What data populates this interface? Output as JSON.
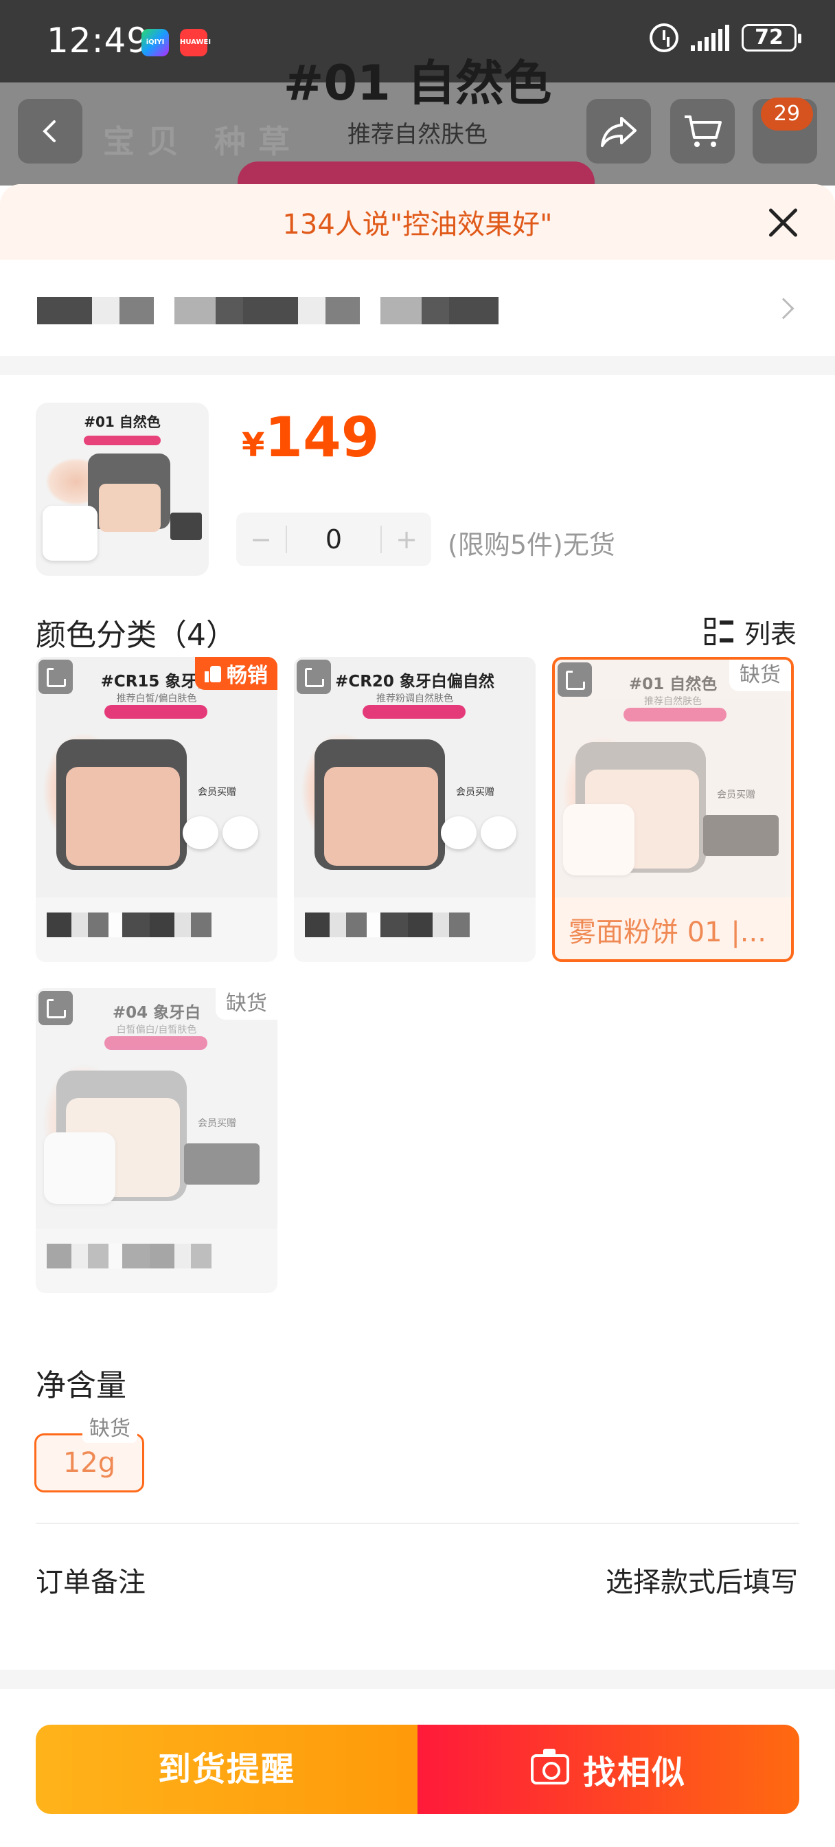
{
  "status_bar": {
    "time": "12:49",
    "apps": [
      "iQIYI",
      "HUAWEI"
    ],
    "battery": "72"
  },
  "background_header": {
    "title": "#01 自然色",
    "subtitle": "推荐自然肤色",
    "tabs": "宝贝 种草",
    "cart_badge": "29"
  },
  "sheet": {
    "banner": "134人说\"控油效果好\"",
    "price_currency": "¥",
    "price": "149",
    "quantity": "0",
    "qty_minus": "−",
    "qty_plus": "+",
    "limit_note": "(限购5件)无货",
    "thumb_label": "#01 自然色",
    "color_section_title": "颜色分类（4）",
    "list_toggle_label": "列表",
    "skus": [
      {
        "name": "#CR15 象牙白",
        "sub": "推荐白皙/偏白肤色",
        "badge": "畅销",
        "state": "hot"
      },
      {
        "name": "#CR20 象牙白偏自然",
        "sub": "推荐粉调自然肤色",
        "badge": "",
        "state": "normal"
      },
      {
        "name": "#01 自然色",
        "sub": "推荐自然肤色",
        "badge": "缺货",
        "state": "selected",
        "caption": "雾面粉饼 01 |..."
      },
      {
        "name": "#04 象牙白",
        "sub": "白皙偏白/自皙肤色",
        "badge": "缺货",
        "state": "oos"
      }
    ],
    "member_gift": "会员买赠",
    "net_section_title": "净含量",
    "size_option": "12g",
    "size_oos": "缺货",
    "note_label": "订单备注",
    "note_action": "选择款式后填写",
    "notify_button": "到货提醒",
    "similar_button": "找相似"
  },
  "colors": {
    "accent_orange": "#ff5000",
    "notify_yellow": "#ffb31a",
    "similar_red": "#ff1a3a",
    "banner_bg": "#fff4ee"
  }
}
